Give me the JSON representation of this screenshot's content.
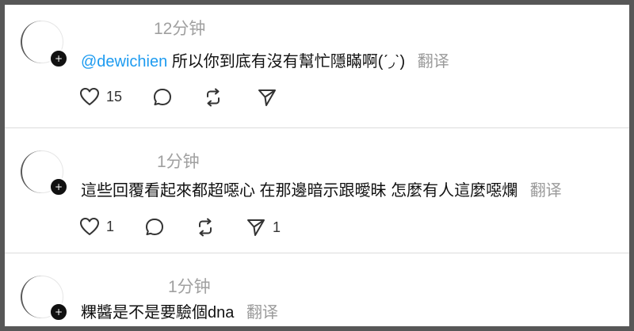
{
  "comments": [
    {
      "time": "12分钟",
      "mention": "@dewichien",
      "text": "所以你到底有沒有幫忙隱瞞啊(ˊ◞ˋ)",
      "translate": "翻译",
      "like_count": "15",
      "share_count": ""
    },
    {
      "time": "1分钟",
      "mention": "",
      "text": "這些回覆看起來都超噁心 在那邊暗示跟曖昧 怎麼有人這麼噁爛",
      "translate": "翻译",
      "like_count": "1",
      "share_count": "1"
    },
    {
      "time": "1分钟",
      "mention": "",
      "text": "粿醬是不是要驗個dna",
      "translate": "翻译"
    }
  ],
  "icons": {
    "avatar_badge": "+",
    "like": "heart-icon",
    "comment": "comment-icon",
    "repost": "repost-icon",
    "share": "send-icon"
  }
}
